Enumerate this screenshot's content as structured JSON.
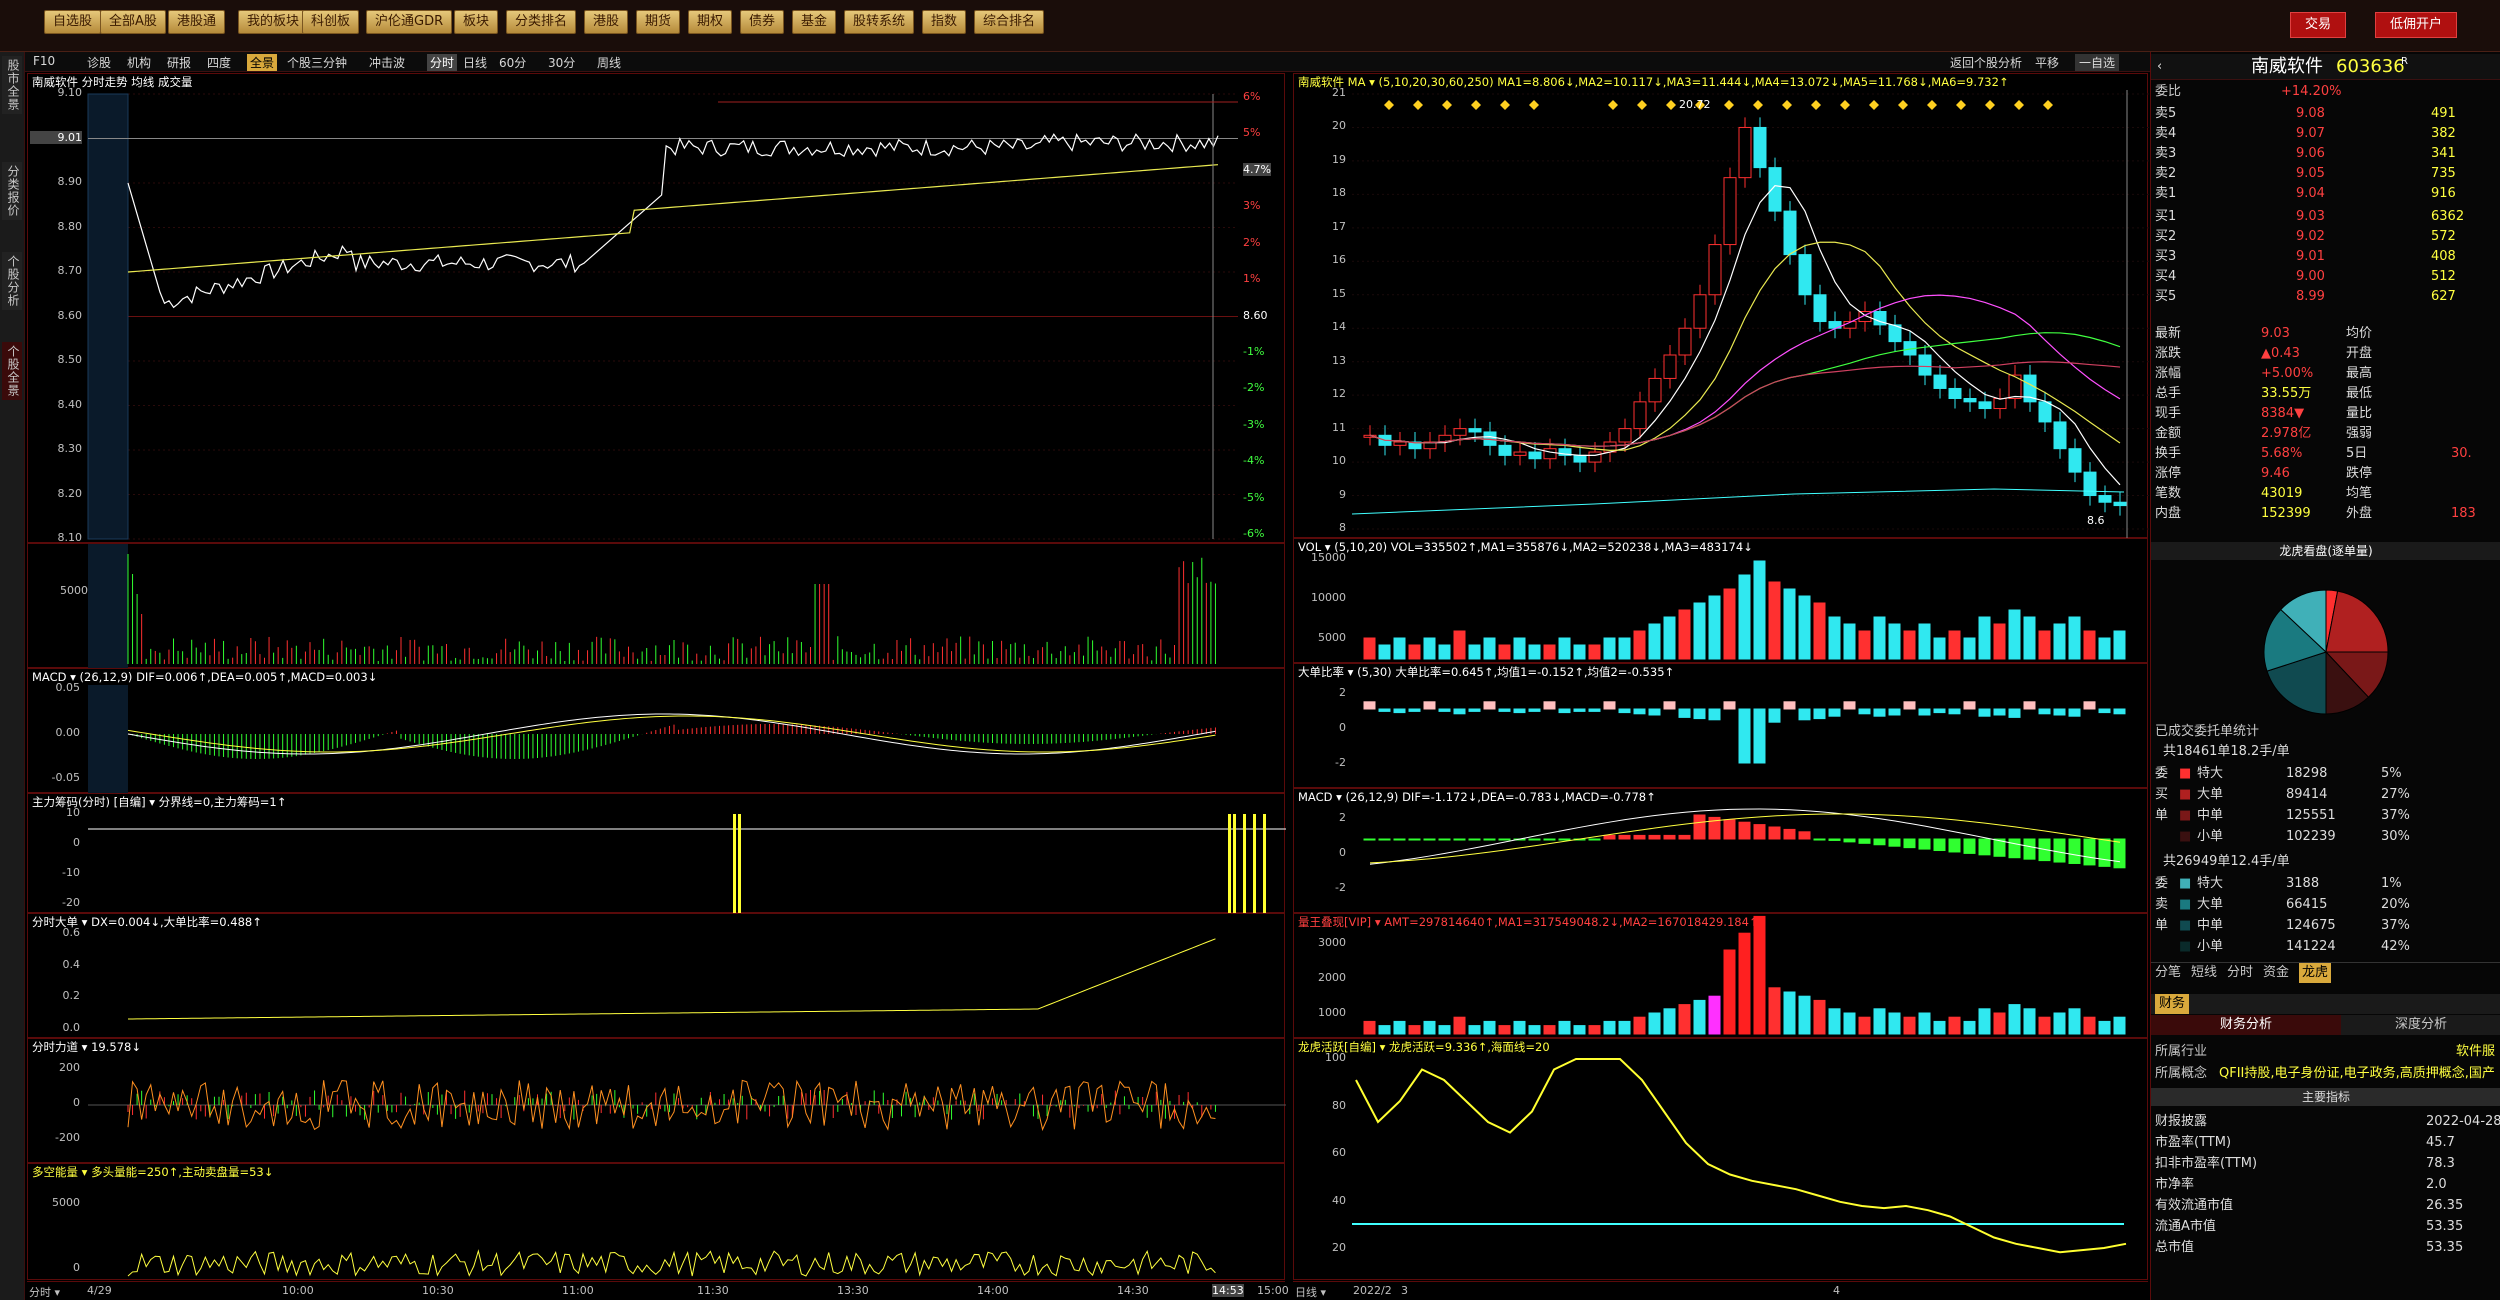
{
  "toolbar": {
    "buttons": [
      "自选股",
      "全部A股",
      "港股通",
      "我的板块",
      "科创板",
      "沪伦通GDR",
      "板块",
      "分类排名",
      "港股",
      "期货",
      "期权",
      "债券",
      "基金",
      "股转系统",
      "指数",
      "综合排名"
    ],
    "trade_label": "交易",
    "open_account_label": "低佣开户"
  },
  "subtabs": {
    "left": [
      "F10",
      "诊股",
      "机构",
      "研报",
      "四度",
      "全景",
      "个股三分钟",
      "冲击波"
    ],
    "active": "全景",
    "periods": [
      "分时",
      "日线",
      "60分",
      "30分",
      "周线"
    ],
    "right": [
      "返回个股分析",
      "平移",
      "一自选"
    ]
  },
  "leftstrip": [
    "股市全景",
    "分类报价",
    "个股分析",
    "个股全景"
  ],
  "intraday": {
    "header": "南威软件  分时走势  均线  成交量",
    "price_ticks": [
      "9.10",
      "9.01",
      "8.90",
      "8.80",
      "8.70",
      "8.60",
      "8.50",
      "8.40",
      "8.30",
      "8.20",
      "8.10"
    ],
    "pct_ticks": [
      "6%",
      "5%",
      "4.7%",
      "3%",
      "2%",
      "1%",
      "8.60",
      "-1%",
      "-2%",
      "-3%",
      "-4%",
      "-5%",
      "-6%"
    ],
    "vol_tick": "5000",
    "macd_header": "MACD ▾  (26,12,9)  DIF=0.006↑,DEA=0.005↑,MACD=0.003↓",
    "macd_ticks": [
      "0.05",
      "0.00",
      "-0.05"
    ],
    "zl_header": "主力筹码(分时)  [自编] ▾  分界线=0,主力筹码=1↑",
    "zl_ticks": [
      "10",
      "0",
      "-10",
      "-20"
    ],
    "dd_header": "分时大单 ▾  DX=0.004↓,大单比率=0.488↑",
    "dd_ticks": [
      "0.6",
      "0.4",
      "0.2",
      "0.0"
    ],
    "fl_header": "分时力道 ▾  19.578↓",
    "fl_ticks": [
      "200",
      "0",
      "-200"
    ],
    "dk_header": "多空能量 ▾  多头量能=250↑,主动卖盘量=53↓",
    "dk_ticks": [
      "5000",
      "0"
    ],
    "time_labels": [
      "分时 ▾",
      "4/29",
      "10:00",
      "10:30",
      "11:00",
      "11:30",
      "13:30",
      "14:00",
      "14:30",
      "14:53",
      "15:00"
    ]
  },
  "daily": {
    "header": "南威软件  MA ▾  (5,10,20,30,60,250)  MA1=8.806↓,MA2=10.117↓,MA3=11.444↓,MA4=13.072↓,MA5=11.768↓,MA6=9.732↑",
    "high_label": "20.72",
    "low_label": "8.6",
    "price_ticks": [
      "21",
      "20",
      "19",
      "18",
      "17",
      "16",
      "15",
      "14",
      "13",
      "12",
      "11",
      "10",
      "9",
      "8"
    ],
    "vol_header": "VOL ▾  (5,10,20)  VOL=335502↑,MA1=355876↓,MA2=520238↓,MA3=483174↓",
    "vol_ticks": [
      "15000",
      "10000",
      "5000"
    ],
    "ddb_header": "大单比率 ▾  (5,30)  大单比率=0.645↑,均值1=-0.152↑,均值2=-0.535↑",
    "ddb_ticks": [
      "2",
      "0",
      "-2"
    ],
    "macd_header": "MACD ▾  (26,12,9)  DIF=-1.172↓,DEA=-0.783↓,MACD=-0.778↑",
    "macd_ticks": [
      "2",
      "0",
      "-2"
    ],
    "lw_header": "量王叠现[VIP] ▾  AMT=297814640↑,MA1=317549048.2↓,MA2=167018429.184↑",
    "lw_ticks": [
      "3000",
      "2000",
      "1000"
    ],
    "lh_header": "龙虎活跃[自编] ▾  龙虎活跃=9.336↑,海面线=20",
    "lh_ticks": [
      "100",
      "80",
      "60",
      "40",
      "20"
    ],
    "time_labels": [
      "日线 ▾",
      "2022/2",
      "3",
      "4"
    ]
  },
  "quote": {
    "name": "南威软件",
    "code": "603636",
    "ratio_label": "委比",
    "ratio_value": "+14.20%",
    "asks": [
      [
        "卖5",
        "9.08",
        "491"
      ],
      [
        "卖4",
        "9.07",
        "382"
      ],
      [
        "卖3",
        "9.06",
        "341"
      ],
      [
        "卖2",
        "9.05",
        "735"
      ],
      [
        "卖1",
        "9.04",
        "916"
      ]
    ],
    "bids": [
      [
        "买1",
        "9.03",
        "6362"
      ],
      [
        "买2",
        "9.02",
        "572"
      ],
      [
        "买3",
        "9.01",
        "408"
      ],
      [
        "买4",
        "9.00",
        "512"
      ],
      [
        "买5",
        "8.99",
        "627"
      ]
    ],
    "stats": [
      [
        "最新",
        "9.03",
        "均价",
        ""
      ],
      [
        "涨跌",
        "▲0.43",
        "开盘",
        ""
      ],
      [
        "涨幅",
        "+5.00%",
        "最高",
        ""
      ],
      [
        "总手",
        "33.55万",
        "最低",
        ""
      ],
      [
        "现手",
        "8384▼",
        "量比",
        ""
      ],
      [
        "金额",
        "2.978亿",
        "强弱",
        ""
      ],
      [
        "换手",
        "5.68%",
        "5日",
        "30."
      ],
      [
        "涨停",
        "9.46",
        "跌停",
        ""
      ],
      [
        "笔数",
        "43019",
        "均笔",
        ""
      ],
      [
        "内盘",
        "152399",
        "外盘",
        "183"
      ]
    ],
    "lhb_title": "龙虎看盘(逐单量)",
    "pie_colors": [
      "#ff3030",
      "#b02020",
      "#7a1818",
      "#3a1010",
      "#104a50",
      "#1a7a80",
      "#40b0b8"
    ],
    "pie_values": [
      0.03,
      0.22,
      0.13,
      0.12,
      0.2,
      0.17,
      0.13
    ],
    "order_title": "已成交委托单统计",
    "buy_summary": "共18461单18.2手/单",
    "buy_rows": [
      [
        "特大",
        "18298",
        "5%"
      ],
      [
        "大单",
        "89414",
        "27%"
      ],
      [
        "中单",
        "125551",
        "37%"
      ],
      [
        "小单",
        "102239",
        "30%"
      ]
    ],
    "sell_summary": "共26949单12.4手/单",
    "sell_rows": [
      [
        "特大",
        "3188",
        "1%"
      ],
      [
        "大单",
        "66415",
        "20%"
      ],
      [
        "中单",
        "124675",
        "37%"
      ],
      [
        "小单",
        "141224",
        "42%"
      ]
    ],
    "buy_side_label": [
      "委",
      "买",
      "单"
    ],
    "sell_side_label": [
      "委",
      "卖",
      "单"
    ],
    "bottom_tabs": [
      "分笔",
      "短线",
      "分时",
      "资金",
      "龙虎"
    ],
    "finance_tab": "财务",
    "fin_tabs": [
      "财务分析",
      "深度分析"
    ],
    "industry_label": "所属行业",
    "industry_value": "软件服",
    "concept_label": "所属概念",
    "concept_value": "QFII持股,电子身份证,电子政务,高质押概念,国产",
    "main_index": "主要指标",
    "fin_rows": [
      [
        "财报披露",
        "2022-04-28"
      ],
      [
        "市盈率(TTM)",
        "45.7"
      ],
      [
        "扣非市盈率(TTM)",
        "78.3"
      ],
      [
        "市净率",
        "2.0"
      ],
      [
        "有效流通市值",
        "26.35"
      ],
      [
        "流通A市值",
        "53.35"
      ],
      [
        "总市值",
        "53.35"
      ]
    ]
  }
}
